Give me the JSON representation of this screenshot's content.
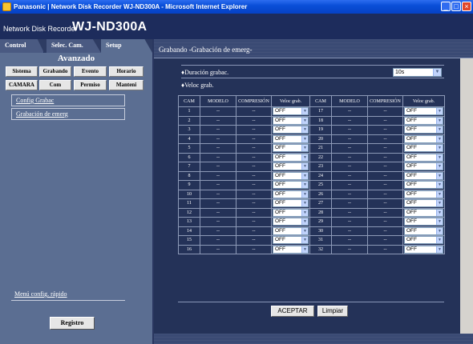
{
  "window": {
    "title": "Panasonic | Network Disk Recorder WJ-ND300A - Microsoft Internet Explorer"
  },
  "header": {
    "product_line": "Network Disk Recorder",
    "model": "WJ-ND300A"
  },
  "tabs": [
    {
      "label": "Control"
    },
    {
      "label": "Selec. Cam."
    },
    {
      "label": "Setup"
    }
  ],
  "sidebar": {
    "section_title": "Avanzado",
    "buttons_row1": [
      "Sistema",
      "Grabando",
      "Evento",
      "Horario"
    ],
    "buttons_row2": [
      "CAMARA",
      "Com",
      "Permiso",
      "Manteni"
    ],
    "submenu": [
      "Config Grabac",
      "Grabación de emerg"
    ],
    "quick_setup": "Menú config. rápido",
    "registro": "Registro"
  },
  "main": {
    "title": "Grabando -Grabación de emerg-",
    "duration_label": "♦Duración grabac.",
    "duration_value": "10s",
    "rate_label": "♦Veloc grab.",
    "columns": [
      "CAM",
      "MODELO",
      "COMPRESIÓN",
      "Veloc grab.",
      "CAM",
      "MODELO",
      "COMPRESIÓN",
      "Veloc grab."
    ],
    "rows": [
      {
        "cam_a": "1",
        "model_a": "--",
        "comp_a": "--",
        "rate_a": "OFF",
        "cam_b": "17",
        "model_b": "--",
        "comp_b": "--",
        "rate_b": "OFF"
      },
      {
        "cam_a": "2",
        "model_a": "--",
        "comp_a": "--",
        "rate_a": "OFF",
        "cam_b": "18",
        "model_b": "--",
        "comp_b": "--",
        "rate_b": "OFF"
      },
      {
        "cam_a": "3",
        "model_a": "--",
        "comp_a": "--",
        "rate_a": "OFF",
        "cam_b": "19",
        "model_b": "--",
        "comp_b": "--",
        "rate_b": "OFF"
      },
      {
        "cam_a": "4",
        "model_a": "--",
        "comp_a": "--",
        "rate_a": "OFF",
        "cam_b": "20",
        "model_b": "--",
        "comp_b": "--",
        "rate_b": "OFF"
      },
      {
        "cam_a": "5",
        "model_a": "--",
        "comp_a": "--",
        "rate_a": "OFF",
        "cam_b": "21",
        "model_b": "--",
        "comp_b": "--",
        "rate_b": "OFF"
      },
      {
        "cam_a": "6",
        "model_a": "--",
        "comp_a": "--",
        "rate_a": "OFF",
        "cam_b": "22",
        "model_b": "--",
        "comp_b": "--",
        "rate_b": "OFF"
      },
      {
        "cam_a": "7",
        "model_a": "--",
        "comp_a": "--",
        "rate_a": "OFF",
        "cam_b": "23",
        "model_b": "--",
        "comp_b": "--",
        "rate_b": "OFF"
      },
      {
        "cam_a": "8",
        "model_a": "--",
        "comp_a": "--",
        "rate_a": "OFF",
        "cam_b": "24",
        "model_b": "--",
        "comp_b": "--",
        "rate_b": "OFF"
      },
      {
        "cam_a": "9",
        "model_a": "--",
        "comp_a": "--",
        "rate_a": "OFF",
        "cam_b": "25",
        "model_b": "--",
        "comp_b": "--",
        "rate_b": "OFF"
      },
      {
        "cam_a": "10",
        "model_a": "--",
        "comp_a": "--",
        "rate_a": "OFF",
        "cam_b": "26",
        "model_b": "--",
        "comp_b": "--",
        "rate_b": "OFF"
      },
      {
        "cam_a": "11",
        "model_a": "--",
        "comp_a": "--",
        "rate_a": "OFF",
        "cam_b": "27",
        "model_b": "--",
        "comp_b": "--",
        "rate_b": "OFF"
      },
      {
        "cam_a": "12",
        "model_a": "--",
        "comp_a": "--",
        "rate_a": "OFF",
        "cam_b": "28",
        "model_b": "--",
        "comp_b": "--",
        "rate_b": "OFF"
      },
      {
        "cam_a": "13",
        "model_a": "--",
        "comp_a": "--",
        "rate_a": "OFF",
        "cam_b": "29",
        "model_b": "--",
        "comp_b": "--",
        "rate_b": "OFF"
      },
      {
        "cam_a": "14",
        "model_a": "--",
        "comp_a": "--",
        "rate_a": "OFF",
        "cam_b": "30",
        "model_b": "--",
        "comp_b": "--",
        "rate_b": "OFF"
      },
      {
        "cam_a": "15",
        "model_a": "--",
        "comp_a": "--",
        "rate_a": "OFF",
        "cam_b": "31",
        "model_b": "--",
        "comp_b": "--",
        "rate_b": "OFF"
      },
      {
        "cam_a": "16",
        "model_a": "--",
        "comp_a": "--",
        "rate_a": "OFF",
        "cam_b": "32",
        "model_b": "--",
        "comp_b": "--",
        "rate_b": "OFF"
      }
    ],
    "accept_label": "ACEPTAR",
    "clear_label": "Limpiar"
  },
  "colors": {
    "title_bar": "#0a4fd8",
    "header_bg": "#1d2c5c",
    "sidebar_bg": "#5b6e92",
    "content_bg": "#243258"
  }
}
